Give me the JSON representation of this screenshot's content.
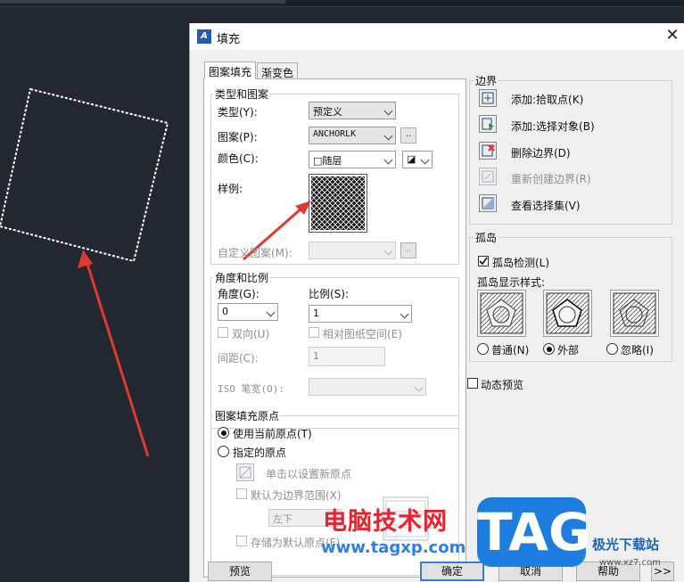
{
  "dialog": {
    "title": "填充",
    "close_label": "✕",
    "app_icon": "hatch-app-icon"
  },
  "tabs": [
    {
      "label": "图案填充",
      "active": true
    },
    {
      "label": "渐变色",
      "active": false
    }
  ],
  "type_pattern": {
    "group_title": "类型和图案",
    "type_label": "类型(Y):",
    "type_value": "预定义",
    "pattern_label": "图案(P):",
    "pattern_value": "ANCHORLK",
    "pattern_more": "..",
    "color_label": "颜色(C):",
    "color_value": "□随层",
    "color_extra": "◪",
    "sample_label": "样例:",
    "custom_label": "自定义图案(M):",
    "custom_more": ".."
  },
  "angle_scale": {
    "group_title": "角度和比例",
    "angle_label": "角度(G):",
    "angle_value": "0",
    "scale_label": "比例(S):",
    "scale_value": "1",
    "double_label": "双向(U)",
    "relative_label": "相对图纸空间(E)",
    "spacing_label": "间距(C):",
    "spacing_value": "1",
    "iso_label": "ISO 笔宽(O):",
    "iso_value": ""
  },
  "origin": {
    "group_title": "图案填充原点",
    "use_current_label": "使用当前原点(T)",
    "specified_label": "指定的原点",
    "click_set_label": "单击以设置新原点",
    "default_extent_label": "默认为边界范围(X)",
    "position_value": "左下",
    "store_default_label": "存储为默认原点(F)"
  },
  "boundary": {
    "group_title": "边界",
    "items": [
      {
        "label": "添加:拾取点(K)",
        "icon": "pick-points-icon",
        "enabled": true
      },
      {
        "label": "添加:选择对象(B)",
        "icon": "select-objects-icon",
        "enabled": true
      },
      {
        "label": "删除边界(D)",
        "icon": "remove-boundary-icon",
        "enabled": true
      },
      {
        "label": "重新创建边界(R)",
        "icon": "recreate-boundary-icon",
        "enabled": false
      },
      {
        "label": "查看选择集(V)",
        "icon": "view-selection-icon",
        "enabled": true
      }
    ]
  },
  "islands": {
    "group_title": "孤岛",
    "detect_label": "孤岛检测(L)",
    "detect_checked": true,
    "style_label": "孤岛显示样式:",
    "styles": [
      {
        "label": "普通(N)",
        "selected": false
      },
      {
        "label": "外部",
        "selected": true
      },
      {
        "label": "忽略(I)",
        "selected": false
      }
    ]
  },
  "dynamic_preview_label": "动态预览",
  "buttons": {
    "preview": "预览",
    "ok": "确定",
    "cancel": "取消",
    "help": "帮助",
    "expand": ">>"
  },
  "watermark": {
    "title": "电脑技术网",
    "url": "www.tagxp.com",
    "tag": "TAG",
    "site": "极光下载站",
    "site2": "www.xz7.com"
  },
  "colors": {
    "background": "#232830",
    "dialog": "#f0f0f0",
    "arrow": "#e03a2f",
    "accent": "#3c7fd1"
  }
}
